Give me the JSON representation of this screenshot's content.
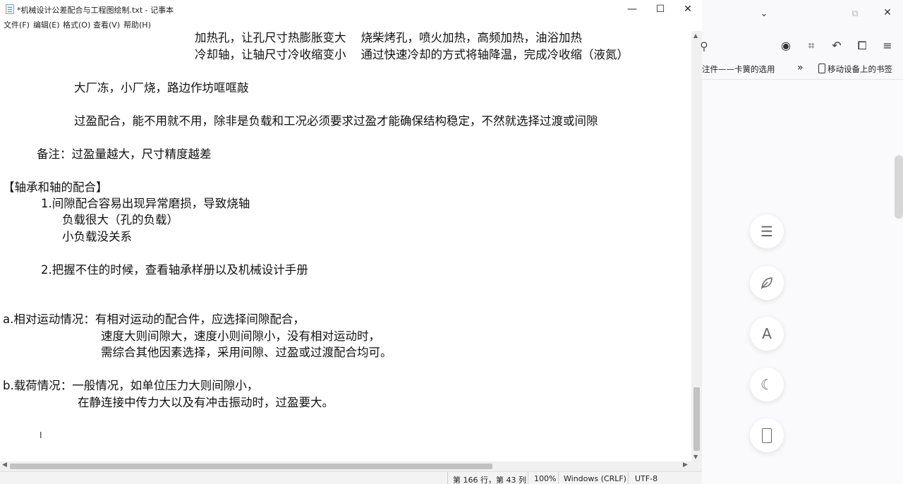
{
  "notepad": {
    "title": "*机械设计公差配合与工程图绘制.txt - 记事本",
    "menu": [
      "文件(F)",
      "编辑(E)",
      "格式(O)",
      "查看(V)",
      "帮助(H)"
    ],
    "lines": [
      "加热孔，让孔尺寸热膨胀变大    烧柴烤孔，喷火加热，高频加热，油浴加热",
      "冷却轴，让轴尺寸冷收缩变小    通过快速冷却的方式将轴降温，完成冷收缩（液氮）",
      "大厂冻，小厂烧，路边作坊哐哐敲",
      "过盈配合，能不用就不用，除非是负载和工况必须要求过盈才能确保结构稳定，不然就选择过渡或间隙",
      "备注：过盈量越大，尺寸精度越差",
      "【轴承和轴的配合】",
      "1.间隙配合容易出现异常磨损，导致烧轴",
      "负载很大（孔的负载）",
      "小负载没关系",
      "2.把握不住的时候，查看轴承样册以及机械设计手册",
      "a.相对运动情况：有相对运动的配合件，应选择间隙配合，",
      "速度大则间隙大，速度小则间隙小，没有相对运动时，",
      "需综合其他因素选择，采用间隙、过盈或过渡配合均可。",
      "b.载荷情况：一般情况，如单位压力大则间隙小，",
      "在静连接中传力大以及有冲击振动时，过盈要大。"
    ],
    "status": {
      "position": "第 166 行，第 43 列",
      "zoom": "100%",
      "line_ending": "Windows (CRLF)",
      "encoding": "UTF-8"
    }
  },
  "browser": {
    "bookmarks": [
      "注件——卡簧的选用",
      "移动设备上的书签"
    ],
    "overflow": "»"
  }
}
